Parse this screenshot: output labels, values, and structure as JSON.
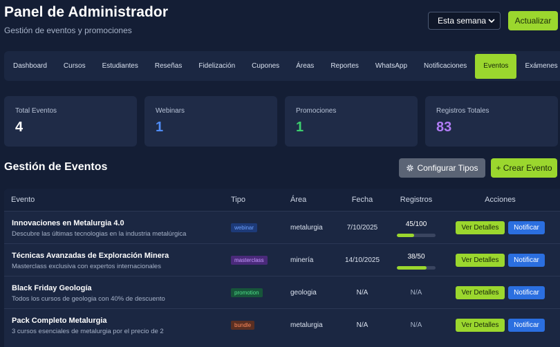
{
  "header": {
    "title": "Panel de Administrador",
    "subtitle": "Gestión de eventos y promociones"
  },
  "period_select": {
    "value": "Esta semana"
  },
  "refresh_label": "Actualizar",
  "tabs": [
    {
      "label": "Dashboard"
    },
    {
      "label": "Cursos"
    },
    {
      "label": "Estudiantes"
    },
    {
      "label": "Reseñas"
    },
    {
      "label": "Fidelización"
    },
    {
      "label": "Cupones"
    },
    {
      "label": "Áreas"
    },
    {
      "label": "Reportes"
    },
    {
      "label": "WhatsApp"
    },
    {
      "label": "Notificaciones"
    },
    {
      "label": "Eventos",
      "active": true
    },
    {
      "label": "Exámenes"
    }
  ],
  "stats": [
    {
      "label": "Total Eventos",
      "value": "4",
      "color": "#ffffff"
    },
    {
      "label": "Webinars",
      "value": "1",
      "color": "#4f8cf7"
    },
    {
      "label": "Promociones",
      "value": "1",
      "color": "#3ccf6e"
    },
    {
      "label": "Registros Totales",
      "value": "83",
      "color": "#b07cf5"
    }
  ],
  "section_title": "Gestión de Eventos",
  "configure_button": {
    "icon": "gear-icon",
    "label": "Configurar Tipos"
  },
  "create_button": {
    "label": "+ Crear Evento"
  },
  "table": {
    "headers": {
      "evento": "Evento",
      "tipo": "Tipo",
      "area": "Área",
      "fecha": "Fecha",
      "registros": "Registros",
      "acciones": "Acciones"
    },
    "rows": [
      {
        "name": "Innovaciones en Metalurgia 4.0",
        "desc": "Descubre las últimas tecnologias en la industria metalúrgica",
        "tipo": "webinar",
        "tipo_bg": "#1d3a78",
        "tipo_color": "#6fa2ff",
        "area": "metalurgia",
        "fecha": "7/10/2025",
        "registros": "45/100",
        "progress": 0.45
      },
      {
        "name": "Técnicas Avanzadas de Exploración Minera",
        "desc": "Masterclass exclusiva con expertos internacionales",
        "tipo": "masterclass",
        "tipo_bg": "#4a2a7a",
        "tipo_color": "#c79bff",
        "area": "minería",
        "fecha": "14/10/2025",
        "registros": "38/50",
        "progress": 0.76
      },
      {
        "name": "Black Friday Geología",
        "desc": "Todos los cursos de geologia con 40% de descuento",
        "tipo": "promotion",
        "tipo_bg": "#17553a",
        "tipo_color": "#4fe08a",
        "area": "geologia",
        "fecha": "N/A",
        "registros": "N/A",
        "progress": null
      },
      {
        "name": "Pack Completo Metalurgia",
        "desc": "3 cursos esenciales de metalurgia por el precio de 2",
        "tipo": "bundle",
        "tipo_bg": "#5a2f22",
        "tipo_color": "#ff8a5c",
        "area": "metalurgia",
        "fecha": "N/A",
        "registros": "N/A",
        "progress": null
      }
    ],
    "details_label": "Ver Detalles",
    "notify_label": "Notificar"
  }
}
